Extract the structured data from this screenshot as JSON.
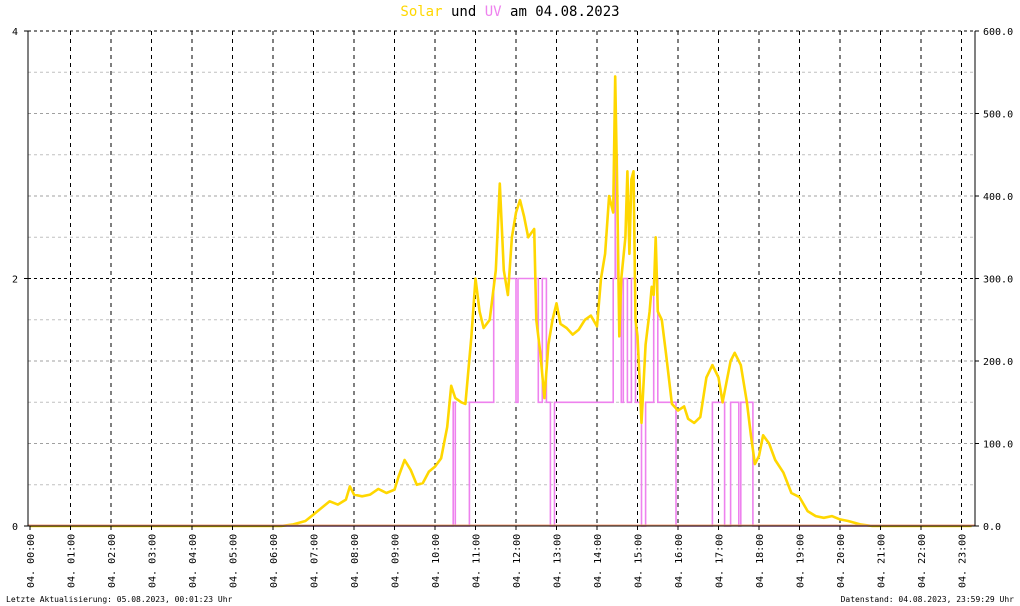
{
  "title": {
    "solar_word": "Solar",
    "und": "und",
    "uv_word": "UV",
    "am_date": "am 04.08.2023"
  },
  "footer": {
    "left": "Letzte Aktualisierung: 05.08.2023, 00:01:23 Uhr",
    "right": "Datenstand: 04.08.2023, 23:59:29 Uhr"
  },
  "colors": {
    "solar": "#ffd700",
    "uv": "#ee82ee",
    "grid": "#000000",
    "minor_grid": "#c0c0c0"
  },
  "chart_data": {
    "type": "line",
    "title": "Solar und UV am 04.08.2023",
    "x_tick_labels": [
      "04. 00:00",
      "04. 01:00",
      "04. 02:00",
      "04. 03:00",
      "04. 04:00",
      "04. 05:00",
      "04. 06:00",
      "04. 07:00",
      "04. 08:00",
      "04. 09:00",
      "04. 10:00",
      "04. 11:00",
      "04. 12:00",
      "04. 13:00",
      "04. 14:00",
      "04. 15:00",
      "04. 16:00",
      "04. 17:00",
      "04. 18:00",
      "04. 19:00",
      "04. 20:00",
      "04. 21:00",
      "04. 22:00",
      "04. 23:00"
    ],
    "x_range_hours": [
      0,
      23.25
    ],
    "y_left": {
      "range": [
        0,
        4
      ],
      "ticks": [
        "0",
        "2",
        "4"
      ]
    },
    "y_right": {
      "range": [
        0,
        600
      ],
      "ticks": [
        "0.0",
        "100.0",
        "200.0",
        "300.0",
        "400.0",
        "500.0",
        "600.0"
      ]
    },
    "grid": true,
    "series": [
      {
        "name": "Solar",
        "axis": "right",
        "points": [
          [
            0,
            0
          ],
          [
            6.2,
            0
          ],
          [
            6.5,
            2
          ],
          [
            6.8,
            6
          ],
          [
            7.0,
            14
          ],
          [
            7.2,
            22
          ],
          [
            7.4,
            30
          ],
          [
            7.6,
            26
          ],
          [
            7.8,
            32
          ],
          [
            7.9,
            48
          ],
          [
            8.0,
            38
          ],
          [
            8.2,
            36
          ],
          [
            8.4,
            38
          ],
          [
            8.6,
            45
          ],
          [
            8.8,
            40
          ],
          [
            9.0,
            44
          ],
          [
            9.1,
            60
          ],
          [
            9.25,
            80
          ],
          [
            9.4,
            68
          ],
          [
            9.55,
            50
          ],
          [
            9.7,
            52
          ],
          [
            9.85,
            66
          ],
          [
            10.0,
            72
          ],
          [
            10.15,
            82
          ],
          [
            10.3,
            120
          ],
          [
            10.4,
            170
          ],
          [
            10.5,
            155
          ],
          [
            10.65,
            150
          ],
          [
            10.75,
            148
          ],
          [
            10.9,
            230
          ],
          [
            11.0,
            300
          ],
          [
            11.1,
            260
          ],
          [
            11.2,
            240
          ],
          [
            11.35,
            250
          ],
          [
            11.5,
            310
          ],
          [
            11.6,
            415
          ],
          [
            11.7,
            310
          ],
          [
            11.8,
            280
          ],
          [
            11.9,
            350
          ],
          [
            12.0,
            380
          ],
          [
            12.1,
            395
          ],
          [
            12.2,
            375
          ],
          [
            12.3,
            350
          ],
          [
            12.45,
            360
          ],
          [
            12.5,
            250
          ],
          [
            12.6,
            210
          ],
          [
            12.7,
            155
          ],
          [
            12.8,
            220
          ],
          [
            12.9,
            250
          ],
          [
            13.0,
            270
          ],
          [
            13.1,
            245
          ],
          [
            13.25,
            240
          ],
          [
            13.4,
            232
          ],
          [
            13.55,
            238
          ],
          [
            13.7,
            250
          ],
          [
            13.85,
            255
          ],
          [
            14.0,
            242
          ],
          [
            14.1,
            300
          ],
          [
            14.2,
            330
          ],
          [
            14.3,
            400
          ],
          [
            14.4,
            380
          ],
          [
            14.45,
            545
          ],
          [
            14.5,
            400
          ],
          [
            14.55,
            230
          ],
          [
            14.6,
            300
          ],
          [
            14.7,
            350
          ],
          [
            14.75,
            430
          ],
          [
            14.8,
            330
          ],
          [
            14.85,
            420
          ],
          [
            14.9,
            430
          ],
          [
            14.95,
            250
          ],
          [
            15.0,
            230
          ],
          [
            15.05,
            180
          ],
          [
            15.1,
            125
          ],
          [
            15.2,
            220
          ],
          [
            15.3,
            260
          ],
          [
            15.35,
            290
          ],
          [
            15.4,
            280
          ],
          [
            15.45,
            350
          ],
          [
            15.5,
            260
          ],
          [
            15.6,
            250
          ],
          [
            15.7,
            210
          ],
          [
            15.85,
            148
          ],
          [
            16.0,
            140
          ],
          [
            16.15,
            145
          ],
          [
            16.25,
            130
          ],
          [
            16.4,
            125
          ],
          [
            16.55,
            132
          ],
          [
            16.7,
            180
          ],
          [
            16.85,
            195
          ],
          [
            17.0,
            180
          ],
          [
            17.1,
            150
          ],
          [
            17.2,
            175
          ],
          [
            17.3,
            200
          ],
          [
            17.4,
            210
          ],
          [
            17.55,
            195
          ],
          [
            17.7,
            150
          ],
          [
            17.8,
            110
          ],
          [
            17.9,
            75
          ],
          [
            18.0,
            85
          ],
          [
            18.1,
            110
          ],
          [
            18.25,
            100
          ],
          [
            18.4,
            80
          ],
          [
            18.6,
            65
          ],
          [
            18.8,
            40
          ],
          [
            19.0,
            35
          ],
          [
            19.2,
            18
          ],
          [
            19.4,
            12
          ],
          [
            19.6,
            10
          ],
          [
            19.8,
            12
          ],
          [
            20.0,
            8
          ],
          [
            20.2,
            6
          ],
          [
            20.5,
            2
          ],
          [
            20.8,
            0
          ],
          [
            23.25,
            0
          ]
        ]
      },
      {
        "name": "UV",
        "axis": "left",
        "steps": [
          [
            0,
            0
          ],
          [
            10.45,
            0
          ],
          [
            10.45,
            1
          ],
          [
            10.5,
            1
          ],
          [
            10.5,
            0
          ],
          [
            10.85,
            0
          ],
          [
            10.85,
            1
          ],
          [
            11.45,
            1
          ],
          [
            11.45,
            2
          ],
          [
            12.0,
            2
          ],
          [
            12.0,
            1
          ],
          [
            12.05,
            1
          ],
          [
            12.05,
            2
          ],
          [
            12.55,
            2
          ],
          [
            12.55,
            1
          ],
          [
            12.65,
            1
          ],
          [
            12.65,
            2
          ],
          [
            12.75,
            2
          ],
          [
            12.75,
            1
          ],
          [
            12.85,
            1
          ],
          [
            12.85,
            0
          ],
          [
            12.95,
            0
          ],
          [
            12.95,
            1
          ],
          [
            14.4,
            1
          ],
          [
            14.4,
            2
          ],
          [
            14.45,
            2
          ],
          [
            14.45,
            3
          ],
          [
            14.5,
            3
          ],
          [
            14.5,
            2
          ],
          [
            14.6,
            2
          ],
          [
            14.6,
            1
          ],
          [
            14.65,
            1
          ],
          [
            14.65,
            2
          ],
          [
            14.75,
            2
          ],
          [
            14.75,
            1
          ],
          [
            14.85,
            1
          ],
          [
            14.85,
            2
          ],
          [
            14.95,
            2
          ],
          [
            14.95,
            1
          ],
          [
            15.1,
            1
          ],
          [
            15.1,
            0
          ],
          [
            15.2,
            0
          ],
          [
            15.2,
            1
          ],
          [
            15.4,
            1
          ],
          [
            15.4,
            2
          ],
          [
            15.5,
            2
          ],
          [
            15.5,
            1
          ],
          [
            15.95,
            1
          ],
          [
            15.95,
            0
          ],
          [
            16.85,
            0
          ],
          [
            16.85,
            1
          ],
          [
            17.15,
            1
          ],
          [
            17.15,
            0
          ],
          [
            17.3,
            0
          ],
          [
            17.3,
            1
          ],
          [
            17.5,
            1
          ],
          [
            17.5,
            0
          ],
          [
            17.55,
            0
          ],
          [
            17.55,
            1
          ],
          [
            17.85,
            1
          ],
          [
            17.85,
            0
          ],
          [
            23.25,
            0
          ]
        ]
      }
    ]
  }
}
